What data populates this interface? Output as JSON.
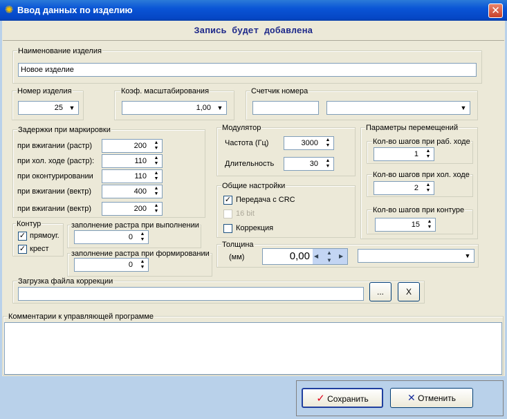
{
  "window": {
    "title": "Ввод данных по изделию",
    "app_icon": "gear-icon",
    "close_glyph": "✕"
  },
  "header": {
    "status": "Запись будет добавлена"
  },
  "name_group": {
    "legend": "Наименование изделия",
    "value": "Новое изделие"
  },
  "number_group": {
    "legend": "Номер изделия",
    "value": "25"
  },
  "scale_group": {
    "legend": "Коэф. масштабирования",
    "value": "1,00"
  },
  "counter_group": {
    "legend": "Счетчик номера",
    "value": "",
    "combo_value": ""
  },
  "delays": {
    "legend": "Задержки при маркировки",
    "rows": [
      {
        "label": "при вжигании (растр)",
        "value": "200"
      },
      {
        "label": "при хол. ходе (растр):",
        "value": "110"
      },
      {
        "label": "при оконтурировании",
        "value": "110"
      },
      {
        "label": "при вжигании (вектр)",
        "value": "400"
      },
      {
        "label": "при вжигании (вектр)",
        "value": "200"
      }
    ]
  },
  "modulator": {
    "legend": "Модулятор",
    "freq_label": "Частота (Гц)",
    "freq_value": "3000",
    "dur_label": "Длительность",
    "dur_value": "30"
  },
  "general": {
    "legend": "Общие настройки",
    "crc_label": "Передача с CRC",
    "crc_checked": true,
    "bit16_label": "16 bit",
    "bit16_checked": false,
    "correction_label": "Коррекция",
    "correction_checked": false
  },
  "moves": {
    "legend": "Параметры перемещений",
    "work_legend": "Кол-во шагов при раб. ходе",
    "work_value": "1",
    "idle_legend": "Кол-во шагов при хол. ходе",
    "idle_value": "2",
    "contour_legend": "Кол-во шагов при контуре",
    "contour_value": "15"
  },
  "contour": {
    "legend": "Контур",
    "rect_label": "прямоуг.",
    "rect_checked": true,
    "cross_label": "крест",
    "cross_checked": true
  },
  "fill_exec": {
    "legend": "заполнение растра при выполнении",
    "value": "0"
  },
  "fill_form": {
    "legend": "заполнение растра при формировании",
    "value": "0"
  },
  "thickness": {
    "legend": "Толщина",
    "unit_label": "(мм)",
    "value": "0,00",
    "combo_value": ""
  },
  "correction_file": {
    "legend": "Загрузка файла коррекции",
    "value": "",
    "browse_label": "...",
    "clear_label": "X"
  },
  "comments": {
    "legend": "Комментарии к управляющей программе",
    "value": ""
  },
  "footer": {
    "save_label": "Сохранить",
    "cancel_label": "Отменить"
  },
  "colors": {
    "check_green": "#e0001b",
    "cancel_x": "#1a2f9e",
    "titlebar": "#0a55d6",
    "header_text": "#1f2a8a"
  }
}
